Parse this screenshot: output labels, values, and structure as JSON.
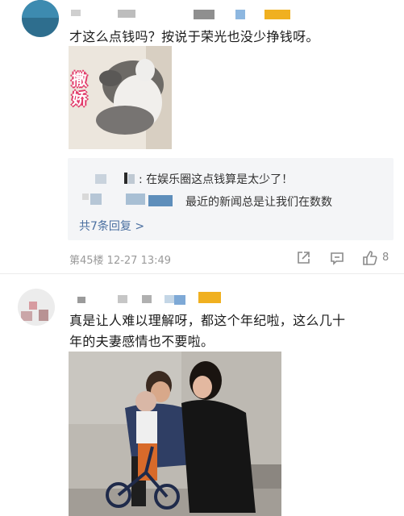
{
  "comment1": {
    "text": "才这么点钱吗？按说于荣光也没少挣钱呀。",
    "sticker_caption": "撒娇",
    "replies": [
      {
        "text": "在娱乐圈这点钱算是太少了！"
      },
      {
        "text": "最近的新闻总是让我们在数数"
      }
    ],
    "more_replies": "共7条回复 >",
    "floor_time": "第45楼 12-27 13:49",
    "like_count": "8"
  },
  "comment2": {
    "text_line1": "真是让人难以理解呀，都这个年纪啦，这么几十",
    "text_line2": "年的夫妻感情也不要啦。"
  },
  "icons": [
    "share-icon",
    "comment-icon",
    "like-icon"
  ],
  "colors": {
    "link": "#4a6fa0",
    "meta": "#9a9a9a",
    "reply_bg": "#f4f5f7"
  }
}
